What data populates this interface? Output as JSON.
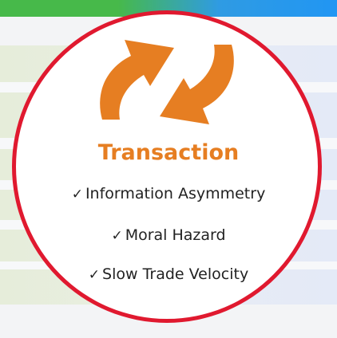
{
  "header": {
    "bar_colors": [
      "#47b94a",
      "#2196f3"
    ]
  },
  "card": {
    "icon": "exchange-arrows-icon",
    "icon_color": "#e67e22",
    "border_color": "#e0192f",
    "title": "Transaction",
    "items": [
      {
        "check": "✓",
        "label": "Information Asymmetry"
      },
      {
        "check": "✓",
        "label": "Moral Hazard"
      },
      {
        "check": "✓",
        "label": "Slow Trade Velocity"
      }
    ]
  }
}
